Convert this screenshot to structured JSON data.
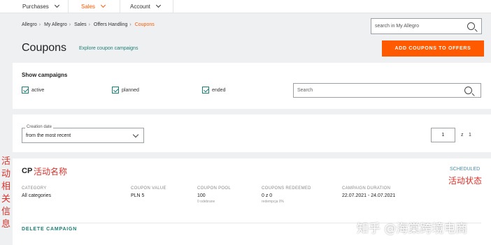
{
  "nav": {
    "items": [
      {
        "label": "Purchases"
      },
      {
        "label": "Sales"
      },
      {
        "label": "Account"
      }
    ]
  },
  "breadcrumb": {
    "items": [
      "Allegro",
      "My Allegro",
      "Sales",
      "Offers Handling"
    ],
    "current": "Coupons"
  },
  "header": {
    "search_placeholder": "search in My Allegro",
    "title": "Coupons",
    "explore_link": "Explore coupon campaigns",
    "add_button": "ADD COUPONS TO OFFERS"
  },
  "filters": {
    "title": "Show campaigns",
    "checkboxes": [
      {
        "label": "active",
        "checked": true
      },
      {
        "label": "planned",
        "checked": true
      },
      {
        "label": "ended",
        "checked": true
      }
    ],
    "search_placeholder": "Search"
  },
  "sort": {
    "label": "Creation date",
    "value": "from the most recent"
  },
  "pager": {
    "page": "1",
    "of_label": "z",
    "total": "1"
  },
  "campaign": {
    "name": "CP",
    "status": "SCHEDULED",
    "columns": [
      {
        "header": "CATEGORY",
        "value": "All categories",
        "sub": ""
      },
      {
        "header": "COUPON VALUE",
        "value": "PLN 5",
        "sub": ""
      },
      {
        "header": "COUPON POOL",
        "value": "100",
        "sub": "0 odebrane"
      },
      {
        "header": "COUPONS REDEEMED",
        "value": "0 z 0",
        "sub": "redempcja 0%"
      },
      {
        "header": "CAMPAIGN DURATION",
        "value": "22.07.2021 - 24.07.2021",
        "sub": ""
      }
    ],
    "delete_label": "DELETE CAMPAIGN"
  },
  "annotations": {
    "left": "活动相关信息",
    "name": "活动名称",
    "status": "活动状态"
  },
  "watermark": "知乎 @海棠跨境电商",
  "colors": {
    "accent": "#ff5a00",
    "teal": "#1b7f73",
    "status": "#4a8ea8",
    "annotation": "#d9332b"
  }
}
